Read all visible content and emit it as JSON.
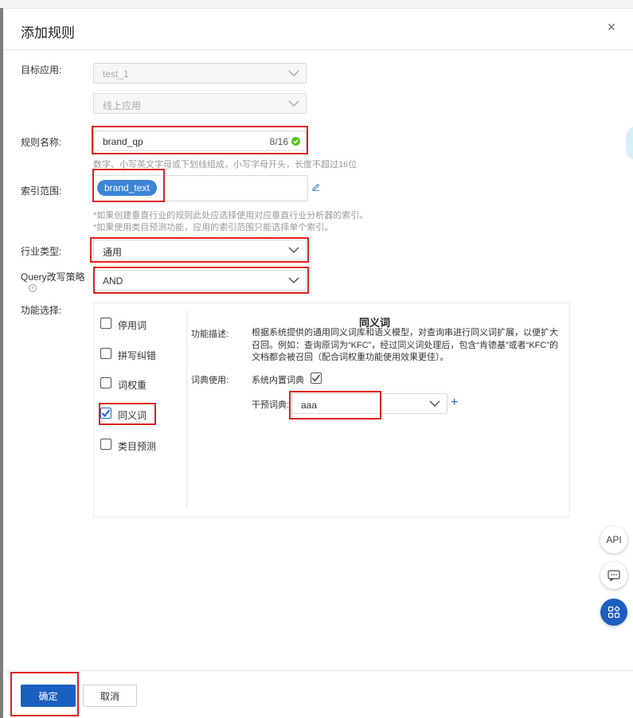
{
  "dialog": {
    "title": "添加规则"
  },
  "labels": {
    "target_app": "目标应用:",
    "rule_name": "规则名称:",
    "index_range": "索引范围:",
    "industry": "行业类型:",
    "query_strategy": "Query改写策略",
    "feature": "功能选择:"
  },
  "target_app": {
    "app_value": "test_1",
    "env_value": "线上应用"
  },
  "rule_name": {
    "value": "brand_qp",
    "counter": "8/16",
    "hint": "数字、小写英文字母或下划线组成，小写字母开头，长度不超过16位"
  },
  "index_range": {
    "tag": "brand_text",
    "hints": [
      "*如果创建垂直行业的规则此处应选择使用对应垂直行业分析器的索引。",
      "*如果使用类目预测功能，应用的索引范围只能选择单个索引。"
    ]
  },
  "industry": {
    "value": "通用"
  },
  "query_strategy": {
    "value": "AND"
  },
  "features": [
    {
      "label": "停用词",
      "checked": false
    },
    {
      "label": "拼写纠错",
      "checked": false
    },
    {
      "label": "词权重",
      "checked": false
    },
    {
      "label": "同义词",
      "checked": true
    },
    {
      "label": "类目预测",
      "checked": false
    }
  ],
  "detail": {
    "title": "同义词",
    "desc_label": "功能描述:",
    "desc": "根据系统提供的通用同义词库和语义模型，对查询串进行同义词扩展，以便扩大召回。例如：查询原词为“KFC”，经过同义词处理后，包含“肯德基”或者“KFC”的文档都会被召回（配合词权重功能使用效果更佳）。",
    "dict_label": "词典使用:",
    "builtin_dict": "系统内置词典",
    "builtin_checked": true,
    "intervene_label": "干预词典:",
    "intervene_value": "aaa"
  },
  "floats": {
    "api": "API"
  },
  "footer": {
    "ok": "确定",
    "cancel": "取消"
  },
  "colors": {
    "primary": "#1b5fc1",
    "highlight": "#e0201f",
    "tag": "#3d84d6",
    "success": "#52c41a"
  }
}
